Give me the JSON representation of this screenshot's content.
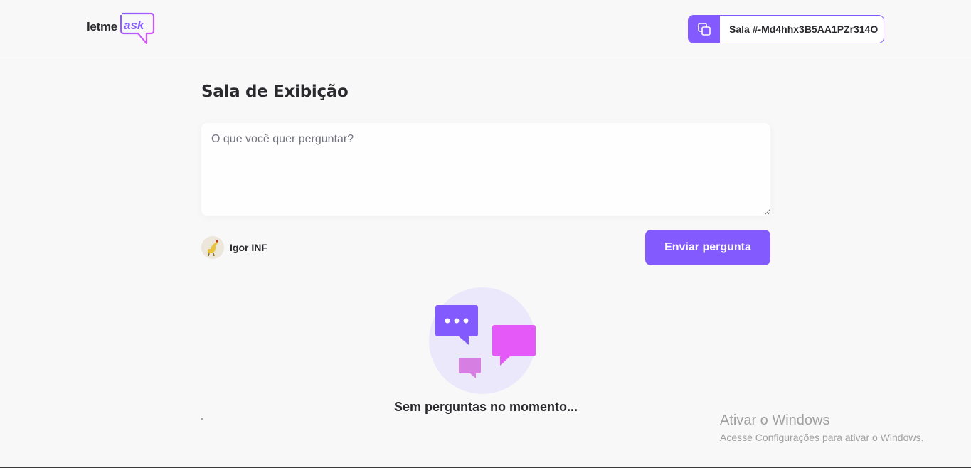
{
  "header": {
    "logo_text_main": "letme",
    "logo_text_accent": "ask",
    "room_code": "Sala #-Md4hhx3B5AA1PZr314O",
    "copy_icon": "copy-icon"
  },
  "main": {
    "room_title": "Sala de Exibição",
    "question_placeholder": "O que você quer perguntar?",
    "user_name": "Igor INF",
    "send_button_label": "Enviar pergunta",
    "empty_state_text": "Sem perguntas no momento...",
    "stray_mark": "'"
  },
  "watermark": {
    "title": "Ativar o Windows",
    "subtitle": "Acesse Configurações para ativar o Windows."
  },
  "colors": {
    "accent": "#835afd",
    "pink": "#e559f9",
    "background": "#f8f8f8"
  }
}
